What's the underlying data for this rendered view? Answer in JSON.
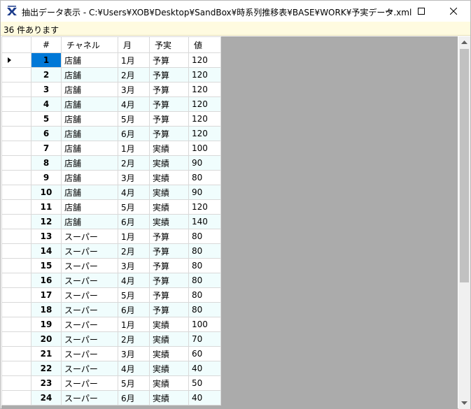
{
  "window": {
    "title": "抽出データ表示 - C:¥Users¥XOB¥Desktop¥SandBox¥時系列推移表¥BASE¥WORK¥予実データ.xml",
    "icons": {
      "app": "app-logo-icon",
      "minimize": "minimize-icon",
      "maximize": "maximize-icon",
      "close": "close-icon"
    }
  },
  "status": {
    "text": "36 件あります"
  },
  "grid": {
    "columns": [
      "#",
      "チャネル",
      "月",
      "予実",
      "値"
    ],
    "selected_row": 1,
    "rows": [
      {
        "num": "1",
        "channel": "店舗",
        "month": "1月",
        "type": "予算",
        "value": "120"
      },
      {
        "num": "2",
        "channel": "店舗",
        "month": "2月",
        "type": "予算",
        "value": "120"
      },
      {
        "num": "3",
        "channel": "店舗",
        "month": "3月",
        "type": "予算",
        "value": "120"
      },
      {
        "num": "4",
        "channel": "店舗",
        "month": "4月",
        "type": "予算",
        "value": "120"
      },
      {
        "num": "5",
        "channel": "店舗",
        "month": "5月",
        "type": "予算",
        "value": "120"
      },
      {
        "num": "6",
        "channel": "店舗",
        "month": "6月",
        "type": "予算",
        "value": "120"
      },
      {
        "num": "7",
        "channel": "店舗",
        "month": "1月",
        "type": "実績",
        "value": "100"
      },
      {
        "num": "8",
        "channel": "店舗",
        "month": "2月",
        "type": "実績",
        "value": "90"
      },
      {
        "num": "9",
        "channel": "店舗",
        "month": "3月",
        "type": "実績",
        "value": "80"
      },
      {
        "num": "10",
        "channel": "店舗",
        "month": "4月",
        "type": "実績",
        "value": "90"
      },
      {
        "num": "11",
        "channel": "店舗",
        "month": "5月",
        "type": "実績",
        "value": "120"
      },
      {
        "num": "12",
        "channel": "店舗",
        "month": "6月",
        "type": "実績",
        "value": "140"
      },
      {
        "num": "13",
        "channel": "スーパー",
        "month": "1月",
        "type": "予算",
        "value": "80"
      },
      {
        "num": "14",
        "channel": "スーパー",
        "month": "2月",
        "type": "予算",
        "value": "80"
      },
      {
        "num": "15",
        "channel": "スーパー",
        "month": "3月",
        "type": "予算",
        "value": "80"
      },
      {
        "num": "16",
        "channel": "スーパー",
        "month": "4月",
        "type": "予算",
        "value": "80"
      },
      {
        "num": "17",
        "channel": "スーパー",
        "month": "5月",
        "type": "予算",
        "value": "80"
      },
      {
        "num": "18",
        "channel": "スーパー",
        "month": "6月",
        "type": "予算",
        "value": "80"
      },
      {
        "num": "19",
        "channel": "スーパー",
        "month": "1月",
        "type": "実績",
        "value": "100"
      },
      {
        "num": "20",
        "channel": "スーパー",
        "month": "2月",
        "type": "実績",
        "value": "70"
      },
      {
        "num": "21",
        "channel": "スーパー",
        "month": "3月",
        "type": "実績",
        "value": "60"
      },
      {
        "num": "22",
        "channel": "スーパー",
        "month": "4月",
        "type": "実績",
        "value": "40"
      },
      {
        "num": "23",
        "channel": "スーパー",
        "month": "5月",
        "type": "実績",
        "value": "50"
      },
      {
        "num": "24",
        "channel": "スーパー",
        "month": "6月",
        "type": "実績",
        "value": "40"
      }
    ]
  },
  "colors": {
    "selection": "#0078d7",
    "alt_row": "#f0fdfd",
    "status_bg": "#fffbe0",
    "grid_bg": "#ababab"
  }
}
